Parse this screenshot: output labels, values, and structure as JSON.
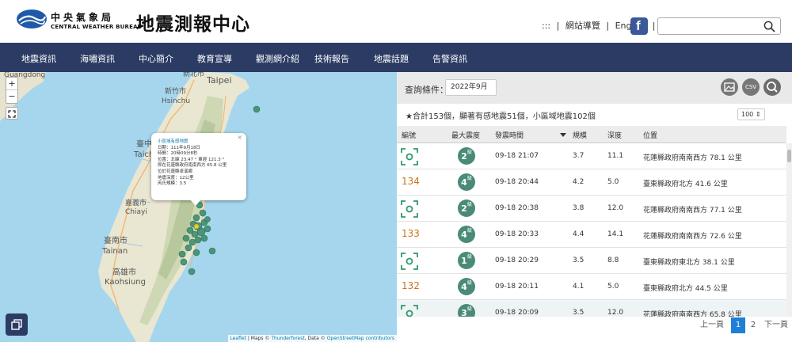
{
  "header": {
    "logo_cn": "中央氣象局",
    "logo_en": "CENTRAL WEATHER BUREAU",
    "title": "地震測報中心",
    "links": [
      ":::",
      "|",
      "網站導覽",
      "|",
      "English",
      "|"
    ],
    "facebook_glyph": "f",
    "search_placeholder": ""
  },
  "nav": [
    "地震資訊",
    "海嘯資訊",
    "中心簡介",
    "教育宣導",
    "觀測網介紹",
    "技術報告",
    "地震話題",
    "告警資訊"
  ],
  "map": {
    "labels": {
      "guangdong": "Guangdong",
      "xinbei": "新北市",
      "taipei": "Taipei",
      "hsinchu_cn": "新竹市",
      "hsinchu": "Hsinchu",
      "taichung_cn": "臺中",
      "taichung": "Taich",
      "chiayi_cn": "嘉義市",
      "chiayi": "Chiayi",
      "tainan_cn": "臺南市",
      "tainan": "Tainan",
      "kaohsiung_cn": "高雄市",
      "kaohsiung": "Kaohsiung"
    },
    "zoom_in": "+",
    "zoom_out": "−",
    "popup": {
      "title": "小區域有感地震",
      "lines": [
        "日期：111年9月18日",
        "時間：20時09分8秒",
        "位置：北緯 23.47 ° 東經 121.3 °",
        "即在花蓮縣政府南南西方 65.8 公里",
        "位於花蓮縣卓溪鄉",
        "地震深度：12公里",
        "芮氏規模：3.5"
      ],
      "close": "×"
    },
    "attribution": {
      "leaflet": "Leaflet",
      "sep1": " | Maps © ",
      "thunderforest": "Thunderforest",
      "sep2": ", Data © ",
      "osm": "OpenStreetMap contributors"
    }
  },
  "query": {
    "label": "查詢條件：",
    "value": "2022年9月",
    "buttons": [
      "image-icon",
      "CSV",
      "search-icon"
    ],
    "csv_label": "CSV"
  },
  "summary": "★合計153個，顯著有感地震51個，小區域地震102個",
  "page_size": "100 ⇕",
  "table": {
    "headers": [
      "編號",
      "最大震度",
      "發震時間",
      "規模",
      "深度",
      "位置"
    ],
    "rows": [
      {
        "no": "",
        "intensity": "2",
        "time": "09-18 21:07",
        "mag": "3.7",
        "depth": "11.1",
        "loc": "花蓮縣政府南南西方 78.1 公里"
      },
      {
        "no": "134",
        "intensity": "4",
        "time": "09-18 20:44",
        "mag": "4.2",
        "depth": "5.0",
        "loc": "臺東縣政府北方 41.6 公里"
      },
      {
        "no": "",
        "intensity": "2",
        "time": "09-18 20:38",
        "mag": "3.8",
        "depth": "12.0",
        "loc": "花蓮縣政府南南西方 77.1 公里"
      },
      {
        "no": "133",
        "intensity": "4",
        "time": "09-18 20:33",
        "mag": "4.4",
        "depth": "14.1",
        "loc": "花蓮縣政府南南西方 72.6 公里"
      },
      {
        "no": "",
        "intensity": "1",
        "time": "09-18 20:29",
        "mag": "3.5",
        "depth": "8.8",
        "loc": "臺東縣政府東北方 38.1 公里"
      },
      {
        "no": "132",
        "intensity": "4",
        "time": "09-18 20:11",
        "mag": "4.1",
        "depth": "5.0",
        "loc": "臺東縣政府北方 44.5 公里"
      },
      {
        "no": "",
        "intensity": "3",
        "time": "09-18 20:09",
        "mag": "3.5",
        "depth": "12.0",
        "loc": "花蓮縣政府南南西方 65.8 公里"
      }
    ],
    "intensity_suffix": "級"
  },
  "pager": {
    "prev": "上一頁",
    "pages": [
      "1",
      "2"
    ],
    "next": "下一頁"
  },
  "colors": {
    "nav_bg": "#2b3b63",
    "intensity_badge": "#4a8a78",
    "event_no": "#c8741a",
    "record_icon": "#2e9a6a",
    "pager_active": "#1e7fd9"
  }
}
